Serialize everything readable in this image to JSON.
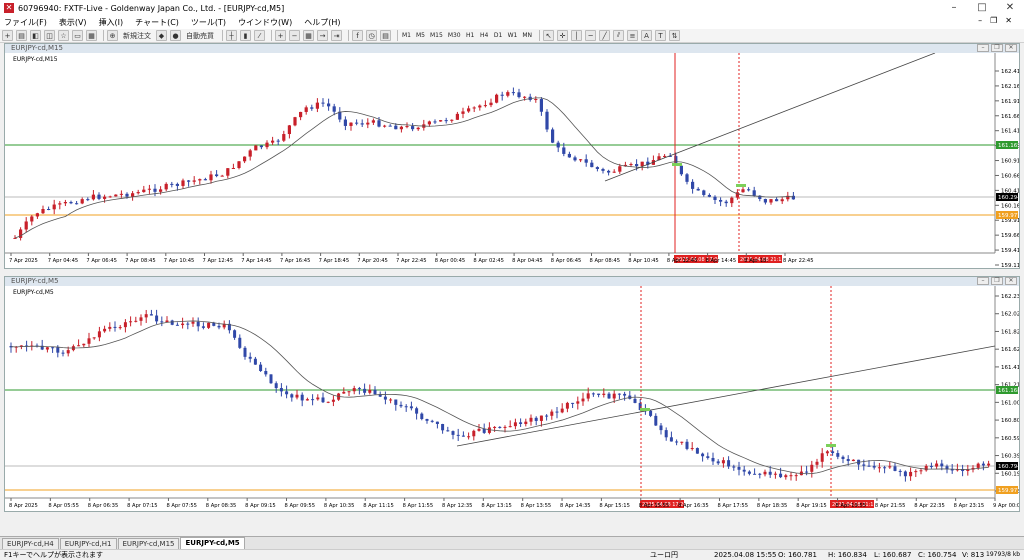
{
  "window": {
    "title": "60796940: FXTF-Live - Goldenway Japan Co., Ltd. - [EURJPY-cd,M5]"
  },
  "menu": [
    "ファイル(F)",
    "表示(V)",
    "挿入(I)",
    "チャート(C)",
    "ツール(T)",
    "ウインドウ(W)",
    "ヘルプ(H)"
  ],
  "toolbar": {
    "new_order": "新規注文",
    "auto_trade": "自動売買",
    "timeframes": [
      "M1",
      "M5",
      "M15",
      "M30",
      "H1",
      "H4",
      "D1",
      "W1",
      "MN"
    ]
  },
  "chart1": {
    "window_title": "EURJPY-cd,M15",
    "label": "EURJPY-cd,M15",
    "price_labels": [
      "162.415",
      "162.165",
      "161.915",
      "161.665",
      "161.415",
      "161.165",
      "160.915",
      "160.665",
      "160.415",
      "160.165",
      "159.910",
      "159.660",
      "159.410",
      "159.110"
    ],
    "highlight_labels": {
      "green": "161.165",
      "current": "160.294",
      "orange": "159.977"
    },
    "time_labels": [
      "7 Apr 2025",
      "7 Apr 04:45",
      "7 Apr 06:45",
      "7 Apr 08:45",
      "7 Apr 10:45",
      "7 Apr 12:45",
      "7 Apr 14:45",
      "7 Apr 16:45",
      "7 Apr 18:45",
      "7 Apr 20:45",
      "7 Apr 22:45",
      "8 Apr 00:45",
      "8 Apr 02:45",
      "8 Apr 04:45",
      "8 Apr 06:45",
      "8 Apr 08:45",
      "8 Apr 10:45",
      "8 Apr 12:45",
      "8 Apr 14:45",
      "8 Apr 18:",
      "8 Apr 22:45"
    ],
    "vline_labels": [
      "2025.04.08 17:00",
      "2025.04.08 21:15"
    ]
  },
  "chart2": {
    "window_title": "EURJPY-cd,M5",
    "label": "EURJPY-cd,M5",
    "price_labels": [
      "162.230",
      "162.025",
      "161.825",
      "161.620",
      "161.415",
      "161.210",
      "161.005",
      "160.800",
      "160.595",
      "160.395",
      "160.190",
      "159.985"
    ],
    "highlight_labels": {
      "green": "161.168",
      "current": "160.794",
      "orange": "159.977"
    },
    "time_labels": [
      "8 Apr 2025",
      "8 Apr 05:55",
      "8 Apr 06:35",
      "8 Apr 07:15",
      "8 Apr 07:55",
      "8 Apr 08:35",
      "8 Apr 09:15",
      "8 Apr 09:55",
      "8 Apr 10:35",
      "8 Apr 11:15",
      "8 Apr 11:55",
      "8 Apr 12:35",
      "8 Apr 13:15",
      "8 Apr 13:55",
      "8 Apr 14:35",
      "8 Apr 15:15",
      "8 Apr 15:55",
      "8 Apr 16:35",
      "8 Apr 17:55",
      "8 Apr 18:35",
      "8 Apr 19:15",
      "8 Apr 19:55",
      "8 Apr 21:55",
      "8 Apr 22:35",
      "8 Apr 23:15",
      "9 Apr 00:00"
    ],
    "vline_labels": [
      "2025.04.08 17:20",
      "2025.04.08 21:15"
    ]
  },
  "tabs": [
    "EURJPY-cd,H4",
    "EURJPY-cd,H1",
    "EURJPY-cd,M15",
    "EURJPY-cd,M5"
  ],
  "status": {
    "help": "F1キーでヘルプが表示されます",
    "profile": "ユーロ円",
    "time": "2025.04.08 15:55",
    "open": "O: 160.781",
    "high": "H: 160.834",
    "low": "L: 160.687",
    "close": "C: 160.754",
    "volume": "V: 813",
    "traffic": "19793/8 kb"
  },
  "colors": {
    "bull": "#c8202a",
    "bear": "#3048a8",
    "ma": "#555555",
    "green_line": "#2e9a2e",
    "orange_line": "#f0a020",
    "vline": "#e02020"
  }
}
